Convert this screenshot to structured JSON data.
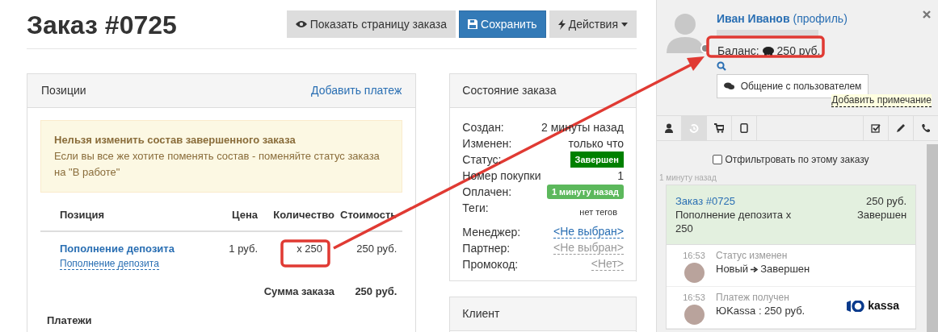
{
  "page": {
    "title": "Заказ #0725"
  },
  "toolbar": [
    {
      "label": "Показать страницу заказа",
      "kind": "view"
    },
    {
      "label": "Сохранить",
      "kind": "save"
    },
    {
      "label": "Действия",
      "kind": "actions"
    }
  ],
  "positions_panel": {
    "title": "Позиции",
    "action": "Добавить платеж",
    "warning": {
      "title": "Нельзя изменить состав завершенного заказа",
      "text": "Если вы все же хотите поменять состав - поменяйте статус заказа на \"В работе\""
    },
    "table": {
      "columns": [
        "Позиция",
        "Цена",
        "Количество",
        "Стоимость"
      ],
      "rows": [
        {
          "name": "Пополнение депозита",
          "subtitle": "Пополнение депозита",
          "price": "1 руб.",
          "quantity": "x 250",
          "cost": "250 руб."
        }
      ],
      "total_label": "Сумма заказа",
      "total": "250 руб."
    },
    "payments_heading": "Платежи"
  },
  "status_panel": {
    "title": "Состояние заказа",
    "fields": [
      {
        "label": "Создан:",
        "value": "2 минуты назад",
        "kind": "text"
      },
      {
        "label": "Изменен:",
        "value": "только что",
        "kind": "text"
      },
      {
        "label": "Статус:",
        "value": "Завершен",
        "kind": "badge",
        "color": "#008000"
      },
      {
        "label": "Номер покупки",
        "value": "1",
        "kind": "text"
      },
      {
        "label": "Оплачен:",
        "value": "1 минуту назад",
        "kind": "badge",
        "color": "#5cb85c"
      },
      {
        "label": "Теги:",
        "value": "нет тегов",
        "kind": "tags"
      },
      {
        "label": "Менеджер:",
        "value": "<Не выбран>",
        "kind": "link"
      },
      {
        "label": "Партнер:",
        "value": "<Не выбран>",
        "kind": "muted"
      },
      {
        "label": "Промокод:",
        "value": "<Нет>",
        "kind": "muted"
      }
    ]
  },
  "client_panel": {
    "title": "Клиент"
  },
  "customer": {
    "name": "Иван Иванов",
    "profile_link": "(профиль)",
    "balance_label": "Баланс:",
    "balance_amount": "250 руб.",
    "chat_button": "Общение с пользователем",
    "add_note": "Добавить примечание"
  },
  "tabs": {
    "left": [
      {
        "kind": "person",
        "selected": false
      },
      {
        "kind": "history",
        "selected": true
      },
      {
        "kind": "cart",
        "selected": false
      },
      {
        "kind": "tablet",
        "selected": false
      }
    ],
    "right": [
      {
        "kind": "tasks",
        "selected": false
      },
      {
        "kind": "pencil",
        "selected": false
      },
      {
        "kind": "phone",
        "selected": false
      }
    ]
  },
  "filter": {
    "label": "Отфильтровать по этому заказу",
    "checked": false
  },
  "feed": {
    "time_group": "1 минуту назад",
    "order_card": {
      "title": "Заказ #0725",
      "amount": "250 руб.",
      "description": "Пополнение депозита x 250",
      "status": "Завершен"
    },
    "events": [
      {
        "kind": "status",
        "time": "16:53",
        "title": "Статус изменен",
        "from": "Новый",
        "to": "Завершен"
      },
      {
        "kind": "payment",
        "time": "16:53",
        "title": "Платеж получен",
        "text": "ЮKassa : 250 руб.",
        "logo_text": "kassa"
      }
    ]
  }
}
